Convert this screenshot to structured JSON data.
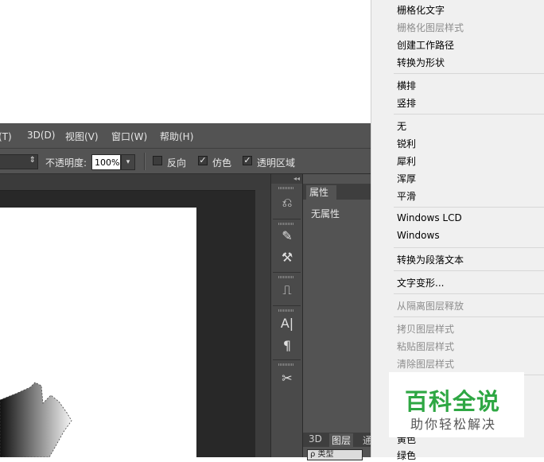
{
  "menubar": {
    "items": [
      {
        "label": "滤镜(T)"
      },
      {
        "label": "3D(D)"
      },
      {
        "label": "视图(V)"
      },
      {
        "label": "窗口(W)"
      },
      {
        "label": "帮助(H)"
      }
    ]
  },
  "options_bar": {
    "opacity_label": "不透明度:",
    "opacity_value": "100%",
    "checkboxes": [
      {
        "label": "反向",
        "checked": false
      },
      {
        "label": "仿色",
        "checked": true
      },
      {
        "label": "透明区域",
        "checked": true
      }
    ]
  },
  "properties_panel": {
    "tab_label": "属性",
    "empty_text": "无属性",
    "bottom_tabs": [
      "3D",
      "图层",
      "通"
    ],
    "filter_label": "ρ 类型"
  },
  "tool_icons": [
    "history-icon",
    "brush-presets-icon",
    "tool-presets-icon",
    "clone-source-icon",
    "character-icon",
    "paragraph-icon",
    "tools-icon"
  ],
  "context_menu": {
    "items": [
      {
        "label": "栅格化文字",
        "disabled": false
      },
      {
        "label": "栅格化图层样式",
        "disabled": true
      },
      {
        "label": "创建工作路径",
        "disabled": false
      },
      {
        "label": "转换为形状",
        "disabled": false
      },
      {
        "label": "横排",
        "disabled": false
      },
      {
        "label": "竖排",
        "disabled": false
      },
      {
        "label": "无",
        "disabled": false
      },
      {
        "label": "锐利",
        "disabled": false
      },
      {
        "label": "犀利",
        "disabled": false
      },
      {
        "label": "浑厚",
        "disabled": false
      },
      {
        "label": "平滑",
        "disabled": false
      },
      {
        "label": "Windows LCD",
        "disabled": false
      },
      {
        "label": "Windows",
        "disabled": false
      },
      {
        "label": "转换为段落文本",
        "disabled": false
      },
      {
        "label": "文字变形...",
        "disabled": false
      },
      {
        "label": "从隔离图层释放",
        "disabled": true
      },
      {
        "label": "拷贝图层样式",
        "disabled": true
      },
      {
        "label": "粘贴图层样式",
        "disabled": true
      },
      {
        "label": "清除图层样式",
        "disabled": true
      },
      {
        "label": "黄色",
        "disabled": false
      },
      {
        "label": "绿色",
        "disabled": false
      }
    ]
  },
  "watermark": {
    "title": "百科全说",
    "subtitle": "助你轻松解决",
    "color": "#2ea743"
  }
}
